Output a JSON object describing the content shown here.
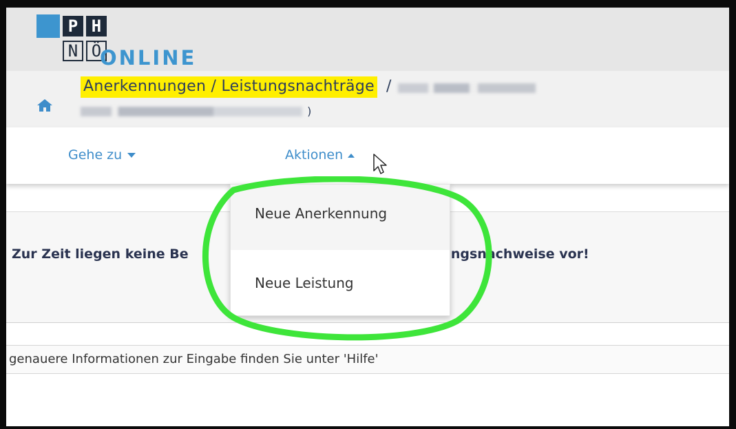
{
  "header": {
    "logo": {
      "top_left": "P",
      "top_right": "H",
      "bottom_left": "N",
      "bottom_right": "Ö",
      "product": "ONLINE"
    },
    "colors": {
      "logo_blue": "#3d95cf",
      "logo_dark": "#1e2a3a"
    }
  },
  "breadcrumb": {
    "home_icon": "home-icon",
    "title": "Anerkennungen / Leistungsnachträge",
    "separator": "/",
    "closing_paren": ")",
    "highlight_color": "#ffef00"
  },
  "navbar": {
    "goto_label": "Gehe zu",
    "actions_label": "Aktionen",
    "link_color": "#3e8dca"
  },
  "dropdown": {
    "items": [
      {
        "label": "Neue Anerkennung"
      },
      {
        "label": "Neue Leistung"
      }
    ]
  },
  "content": {
    "message_left": "Zur Zeit liegen keine Be",
    "message_right": "e/Leistungsnachweise vor!",
    "help_text": "genauere Informationen zur Eingabe finden Sie unter 'Hilfe'"
  },
  "annotation": {
    "color": "#3ee53a"
  }
}
